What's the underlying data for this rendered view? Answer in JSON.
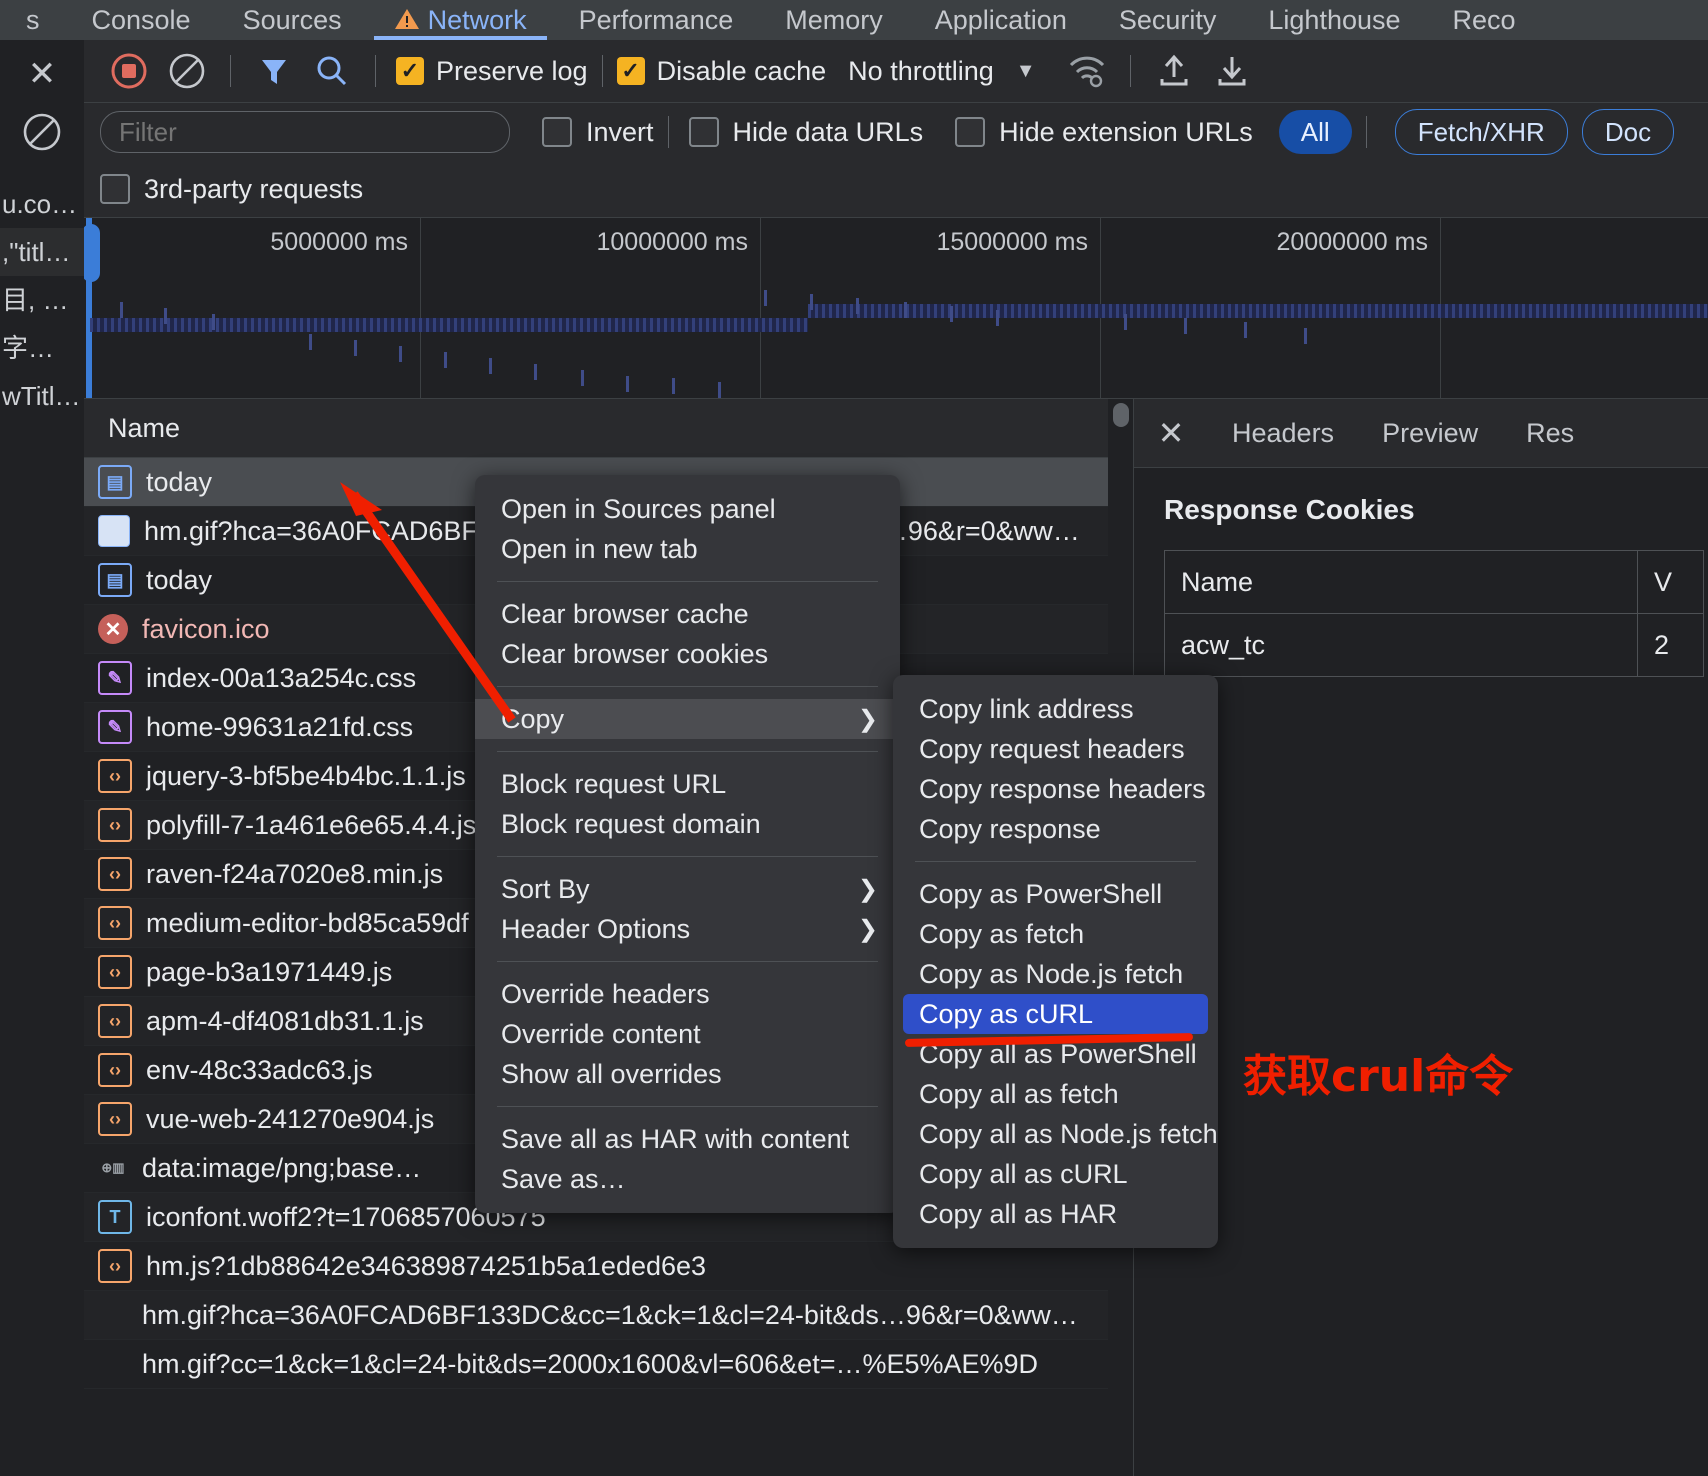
{
  "devtools_tabs": [
    {
      "label": "s",
      "active": false,
      "warn": false
    },
    {
      "label": "Console",
      "active": false,
      "warn": false
    },
    {
      "label": "Sources",
      "active": false,
      "warn": false
    },
    {
      "label": "Network",
      "active": true,
      "warn": true
    },
    {
      "label": "Performance",
      "active": false,
      "warn": false
    },
    {
      "label": "Memory",
      "active": false,
      "warn": false
    },
    {
      "label": "Application",
      "active": false,
      "warn": false
    },
    {
      "label": "Security",
      "active": false,
      "warn": false
    },
    {
      "label": "Lighthouse",
      "active": false,
      "warn": false
    },
    {
      "label": "Reco",
      "active": false,
      "warn": false
    }
  ],
  "toolbar": {
    "record_icon": "record-stop-icon",
    "clear_icon": "clear-icon",
    "filter_icon": "filter-funnel-icon",
    "search_icon": "search-icon",
    "preserve_log_label": "Preserve log",
    "preserve_log_checked": true,
    "disable_cache_label": "Disable cache",
    "disable_cache_checked": true,
    "throttling_value": "No throttling",
    "throttling_caret": "▼",
    "wifi_icon": "wifi-settings-icon",
    "import_icon": "import-har-icon",
    "export_icon": "export-har-icon"
  },
  "filterbar": {
    "filter_placeholder": "Filter",
    "filter_value": "",
    "invert_label": "Invert",
    "invert_checked": false,
    "hide_data_urls_label": "Hide data URLs",
    "hide_data_urls_checked": false,
    "hide_extension_urls_label": "Hide extension URLs",
    "hide_extension_urls_checked": false,
    "types": [
      {
        "label": "All",
        "selected": true
      },
      {
        "label": "Fetch/XHR",
        "selected": false
      },
      {
        "label": "Doc",
        "selected": false
      }
    ],
    "third_party_label": "3rd-party requests",
    "third_party_checked": false
  },
  "overview": {
    "ticks": [
      "5000000 ms",
      "10000000 ms",
      "15000000 ms",
      "20000000 ms"
    ]
  },
  "requests": {
    "column_header": "Name",
    "rows": [
      {
        "name": "today",
        "icon": "document-icon",
        "kind": "doc",
        "selected": true
      },
      {
        "name": "hm.gif?hca=36A0FCAD6BF133DC&cc=1&ck=1&cl=24-bit&ds…96&r=0&ww…",
        "icon": "image-icon",
        "kind": "img",
        "selected": false
      },
      {
        "name": "today",
        "icon": "document-icon",
        "kind": "doc",
        "selected": false
      },
      {
        "name": "favicon.ico",
        "icon": "error-icon",
        "kind": "err",
        "selected": false
      },
      {
        "name": "index-00a13a254c.css",
        "icon": "stylesheet-icon",
        "kind": "css",
        "selected": false
      },
      {
        "name": "home-99631a21fd.css",
        "icon": "stylesheet-icon",
        "kind": "css",
        "selected": false
      },
      {
        "name": "jquery-3-bf5be4b4bc.1.1.js",
        "icon": "script-icon",
        "kind": "js",
        "selected": false
      },
      {
        "name": "polyfill-7-1a461e6e65.4.4.js",
        "icon": "script-icon",
        "kind": "js",
        "selected": false
      },
      {
        "name": "raven-f24a7020e8.min.js",
        "icon": "script-icon",
        "kind": "js",
        "selected": false
      },
      {
        "name": "medium-editor-bd85ca59df",
        "icon": "script-icon",
        "kind": "js",
        "selected": false
      },
      {
        "name": "page-b3a1971449.js",
        "icon": "script-icon",
        "kind": "js",
        "selected": false
      },
      {
        "name": "apm-4-df4081db31.1.js",
        "icon": "script-icon",
        "kind": "js",
        "selected": false
      },
      {
        "name": "env-48c33adc63.js",
        "icon": "script-icon",
        "kind": "js",
        "selected": false
      },
      {
        "name": "vue-web-241270e904.js",
        "icon": "script-icon",
        "kind": "js",
        "selected": false
      },
      {
        "name": "data:image/png;base…",
        "icon": "data-uri-icon",
        "kind": "data",
        "selected": false
      },
      {
        "name": "iconfont.woff2?t=1706857060575",
        "icon": "font-icon",
        "kind": "font",
        "selected": false
      },
      {
        "name": "hm.js?1db88642e346389874251b5a1eded6e3",
        "icon": "script-icon",
        "kind": "js",
        "selected": false
      },
      {
        "name": "hm.gif?hca=36A0FCAD6BF133DC&cc=1&ck=1&cl=24-bit&ds…96&r=0&ww…",
        "icon": "none",
        "kind": "none",
        "selected": false
      },
      {
        "name": "hm.gif?cc=1&ck=1&cl=24-bit&ds=2000x1600&vl=606&et=…%E5%AE%9D",
        "icon": "none",
        "kind": "none",
        "selected": false
      }
    ]
  },
  "details": {
    "close_icon": "close-icon",
    "tabs": [
      "Headers",
      "Preview",
      "Res"
    ],
    "section_title": "Response Cookies",
    "cookie_columns": [
      "Name",
      "V"
    ],
    "cookie_rows": [
      [
        "acw_tc",
        "2"
      ]
    ]
  },
  "context_menu": {
    "groups": [
      [
        {
          "label": "Open in Sources panel",
          "submenu": false,
          "highlighted": false
        },
        {
          "label": "Open in new tab",
          "submenu": false,
          "highlighted": false
        }
      ],
      [
        {
          "label": "Clear browser cache",
          "submenu": false,
          "highlighted": false
        },
        {
          "label": "Clear browser cookies",
          "submenu": false,
          "highlighted": false
        }
      ],
      [
        {
          "label": "Copy",
          "submenu": true,
          "highlighted": true
        }
      ],
      [
        {
          "label": "Block request URL",
          "submenu": false,
          "highlighted": false
        },
        {
          "label": "Block request domain",
          "submenu": false,
          "highlighted": false
        }
      ],
      [
        {
          "label": "Sort By",
          "submenu": true,
          "highlighted": false
        },
        {
          "label": "Header Options",
          "submenu": true,
          "highlighted": false
        }
      ],
      [
        {
          "label": "Override headers",
          "submenu": false,
          "highlighted": false
        },
        {
          "label": "Override content",
          "submenu": false,
          "highlighted": false
        },
        {
          "label": "Show all overrides",
          "submenu": false,
          "highlighted": false
        }
      ],
      [
        {
          "label": "Save all as HAR with content",
          "submenu": false,
          "highlighted": false
        },
        {
          "label": "Save as…",
          "submenu": false,
          "highlighted": false
        }
      ]
    ]
  },
  "copy_submenu": {
    "groups": [
      [
        {
          "label": "Copy link address",
          "selected": false
        },
        {
          "label": "Copy request headers",
          "selected": false
        },
        {
          "label": "Copy response headers",
          "selected": false
        },
        {
          "label": "Copy response",
          "selected": false
        }
      ],
      [
        {
          "label": "Copy as PowerShell",
          "selected": false
        },
        {
          "label": "Copy as fetch",
          "selected": false
        },
        {
          "label": "Copy as Node.js fetch",
          "selected": false
        },
        {
          "label": "Copy as cURL",
          "selected": true
        },
        {
          "label": "Copy all as PowerShell",
          "selected": false
        },
        {
          "label": "Copy all as fetch",
          "selected": false
        },
        {
          "label": "Copy all as Node.js fetch",
          "selected": false
        },
        {
          "label": "Copy all as cURL",
          "selected": false
        },
        {
          "label": "Copy all as HAR",
          "selected": false
        }
      ]
    ]
  },
  "annotations": {
    "note_text": "获取crul命令",
    "note_color": "#f01f00",
    "arrow_color": "#f01f00"
  },
  "console_rail": {
    "messages": [
      "u.co…",
      ",\"titl…",
      "目,  …",
      "字…",
      "wTitl…"
    ],
    "selected_index": 1,
    "close_icon": "close-icon",
    "block_icon": "no-entry-icon"
  }
}
